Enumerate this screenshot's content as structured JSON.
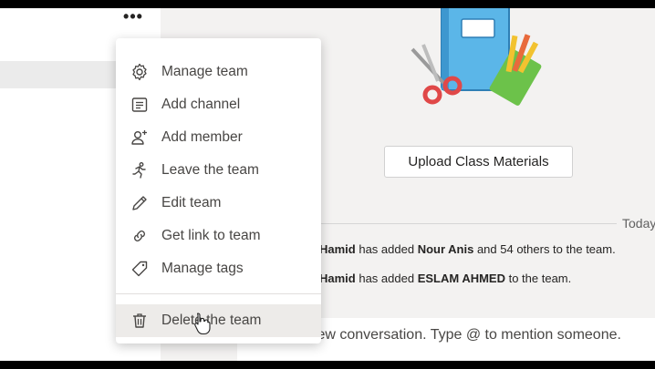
{
  "left_panel": {
    "more_label": "•••"
  },
  "main": {
    "upload_button": "Upload Class Materials",
    "date_divider": "Today",
    "activity": [
      {
        "actor": "Hamid",
        "text1": " has added ",
        "subject": "Nour Anis",
        "text2": " and 54 others to the team."
      },
      {
        "actor": "Hamid",
        "text1": " has added ",
        "subject": "ESLAM AHMED",
        "text2": " to the team."
      }
    ],
    "compose_text": "Start a new conversation. Type @ to mention someone."
  },
  "menu": {
    "items": [
      {
        "label": "Manage team",
        "icon": "gear-icon"
      },
      {
        "label": "Add channel",
        "icon": "channel-icon"
      },
      {
        "label": "Add member",
        "icon": "add-person-icon"
      },
      {
        "label": "Leave the team",
        "icon": "leave-icon"
      },
      {
        "label": "Edit team",
        "icon": "pencil-icon"
      },
      {
        "label": "Get link to team",
        "icon": "link-icon"
      },
      {
        "label": "Manage tags",
        "icon": "tag-icon"
      },
      {
        "label": "Delete the team",
        "icon": "trash-icon"
      }
    ]
  },
  "colors": {
    "menu_text": "#484644",
    "hover_bg": "#edebe9",
    "background": "#f3f2f1"
  }
}
